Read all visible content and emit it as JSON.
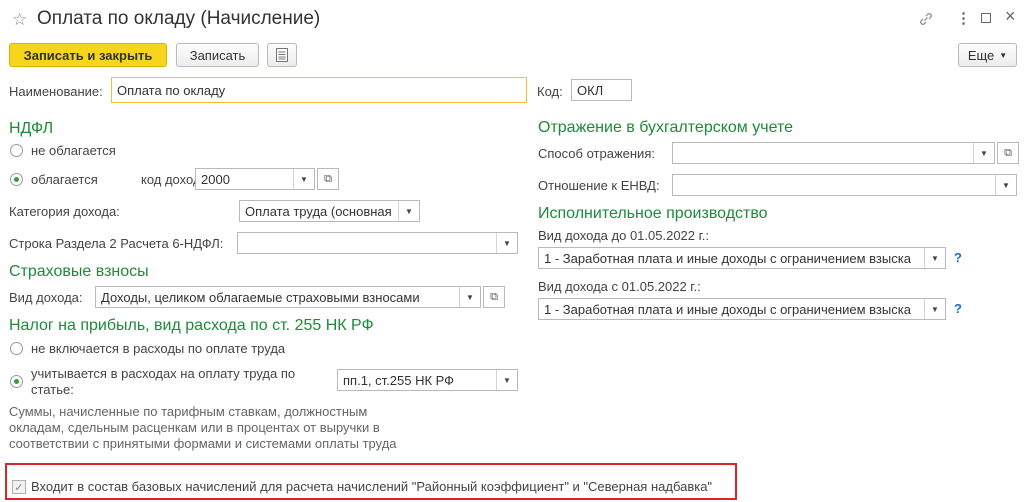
{
  "window": {
    "title": "Оплата по окладу (Начисление)"
  },
  "toolbar": {
    "save_close": "Записать и закрыть",
    "save": "Записать",
    "more": "Еще"
  },
  "header": {
    "name_label": "Наименование:",
    "name_value": "Оплата по окладу",
    "code_label": "Код:",
    "code_value": "ОКЛ"
  },
  "ndfl": {
    "title": "НДФЛ",
    "not_taxed": "не облагается",
    "taxed": "облагается",
    "income_code_label": "код дохода:",
    "income_code": "2000",
    "category_label": "Категория дохода:",
    "category_value": "Оплата труда (основная",
    "row6_label": "Строка Раздела 2 Расчета 6-НДФЛ:",
    "row6_value": ""
  },
  "insurance": {
    "title": "Страховые взносы",
    "kind_label": "Вид дохода:",
    "kind_value": "Доходы, целиком облагаемые страховыми взносами"
  },
  "profit_tax": {
    "title": "Налог на прибыль, вид расхода по ст. 255 НК РФ",
    "option_excluded": "не включается в расходы по оплате труда",
    "option_included": "учитывается в расходах на оплату труда по статье:",
    "article_value": "пп.1, ст.255 НК РФ",
    "note": "Суммы, начисленные по тарифным ставкам, должностным окладам, сдельным расценкам или в процентах от выручки в соответствии с принятыми формами и системами оплаты труда"
  },
  "accounting": {
    "title": "Отражение в бухгалтерском учете",
    "method_label": "Способ отражения:",
    "method_value": "",
    "envd_label": "Отношение к ЕНВД:",
    "envd_value": ""
  },
  "enforcement": {
    "title": "Исполнительное производство",
    "before_label": "Вид дохода до 01.05.2022 г.:",
    "before_value": "1 - Заработная плата и иные доходы с ограничением взыска",
    "after_label": "Вид дохода с 01.05.2022 г.:",
    "after_value": "1 - Заработная плата и иные доходы с ограничением взыска",
    "help": "?"
  },
  "base_accruals": {
    "label": "Входит в состав базовых начислений для расчета начислений \"Районный коэффициент\" и \"Северная надбавка\"",
    "checked": true
  }
}
